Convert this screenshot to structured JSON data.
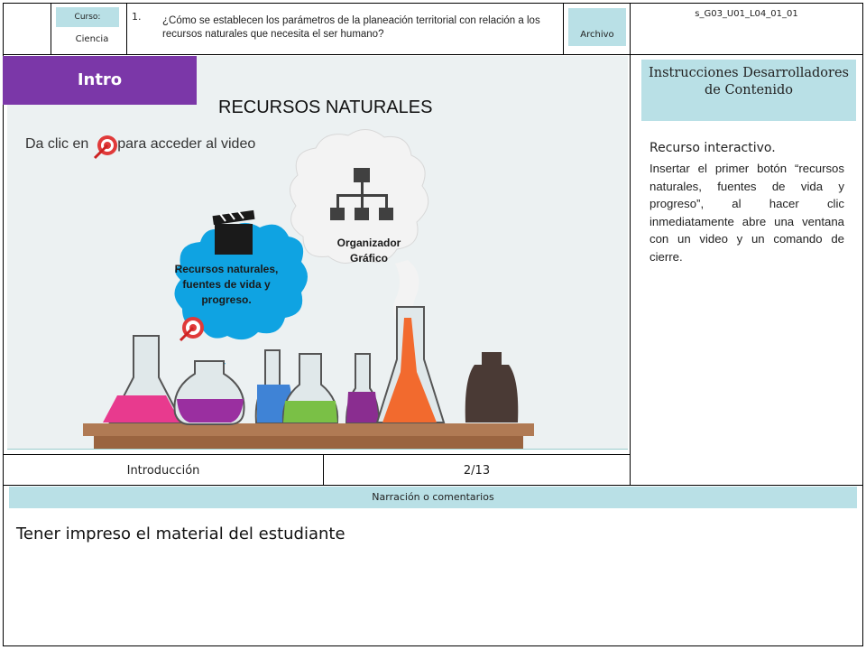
{
  "header": {
    "course_label": "Curso:",
    "course_value": "Ciencia",
    "question_number": "1.",
    "question_text": "¿Cómo se establecen los parámetros de la planeación territorial con relación a los recursos naturales que necesita el ser humano?",
    "archive_label": "Archivo",
    "file_code": "s_G03_U01_L04_01_01"
  },
  "slide": {
    "tab_label": "Intro",
    "title": "RECURSOS NATURALES",
    "instruction_before": "Da clic en",
    "instruction_after": "para acceder al video",
    "video_button_label": "Recursos naturales, fuentes de vida y progreso.",
    "organizer_label": "Organizador Gráfico"
  },
  "developer_panel": {
    "title": "Instrucciones Desarrolladores de Contenido",
    "heading": "Recurso interactivo.",
    "body": "Insertar el primer botón “recursos naturales, fuentes de vida y progreso”, al hacer clic inmediatamente abre una ventana con un video y un comando de cierre."
  },
  "footer": {
    "section": "Introducción",
    "page": "2/13"
  },
  "narration": {
    "label": "Narración o comentarios",
    "text": "Tener impreso el material del estudiante"
  },
  "colors": {
    "accent_light": "#b9e0e6",
    "tab_purple": "#7b37a8",
    "cloud_blue": "#0fa3e2",
    "cloud_gray": "#f3f3f3"
  }
}
